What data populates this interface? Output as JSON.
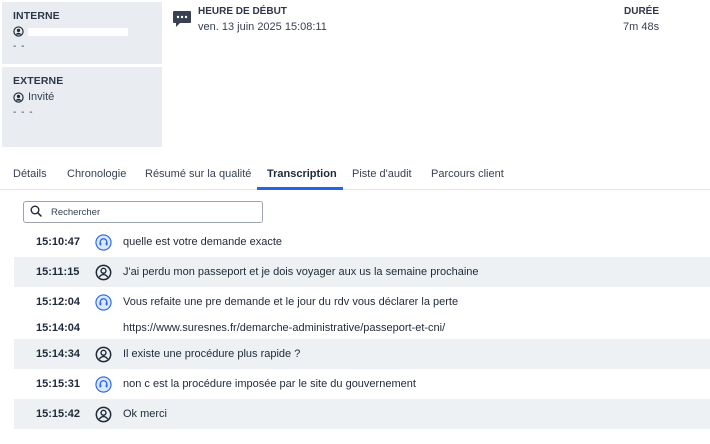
{
  "participants": {
    "internal": {
      "title": "INTERNE",
      "sub": "- -"
    },
    "external": {
      "title": "EXTERNE",
      "name": "Invité",
      "sub": "- -   -"
    }
  },
  "header": {
    "start_label": "HEURE DE DÉBUT",
    "start_value": "ven. 13 juin 2025 15:08:11",
    "duration_label": "DURÉE",
    "duration_value": "7m 48s"
  },
  "tabs": [
    {
      "label": "Détails",
      "active": false
    },
    {
      "label": "Chronologie",
      "active": false
    },
    {
      "label": "Résumé sur la qualité",
      "active": false
    },
    {
      "label": "Transcription",
      "active": true
    },
    {
      "label": "Piste d'audit",
      "active": false
    },
    {
      "label": "Parcours client",
      "active": false
    }
  ],
  "search": {
    "placeholder": "Rechercher"
  },
  "colors": {
    "accent": "#2563eb",
    "agent_icon": "#2563eb",
    "row_shade": "#eef1f4",
    "card_bg": "#e9edf2"
  },
  "transcript": [
    {
      "time": "15:10:47",
      "speaker": "agent",
      "speaker_icon": "headset-icon",
      "text": "quelle est votre demande exacte"
    },
    {
      "time": "15:11:15",
      "speaker": "customer",
      "speaker_icon": "user-icon",
      "text": "J'ai perdu mon passeport et je dois voyager aux us la semaine prochaine"
    },
    {
      "time": "15:12:04",
      "speaker": "agent",
      "speaker_icon": "headset-icon",
      "text": "Vous refaite une pre demande et le jour du rdv vous déclarer la perte"
    },
    {
      "time": "15:14:04",
      "speaker": "agent",
      "speaker_icon": "",
      "text": "https://www.suresnes.fr/demarche-administrative/passeport-et-cni/"
    },
    {
      "time": "15:14:34",
      "speaker": "customer",
      "speaker_icon": "user-icon",
      "text": "Il existe une procédure plus rapide ?"
    },
    {
      "time": "15:15:31",
      "speaker": "agent",
      "speaker_icon": "headset-icon",
      "text": "non c est la procédure imposée par le site du gouvernement"
    },
    {
      "time": "15:15:42",
      "speaker": "customer",
      "speaker_icon": "user-icon",
      "text": "Ok merci"
    }
  ]
}
